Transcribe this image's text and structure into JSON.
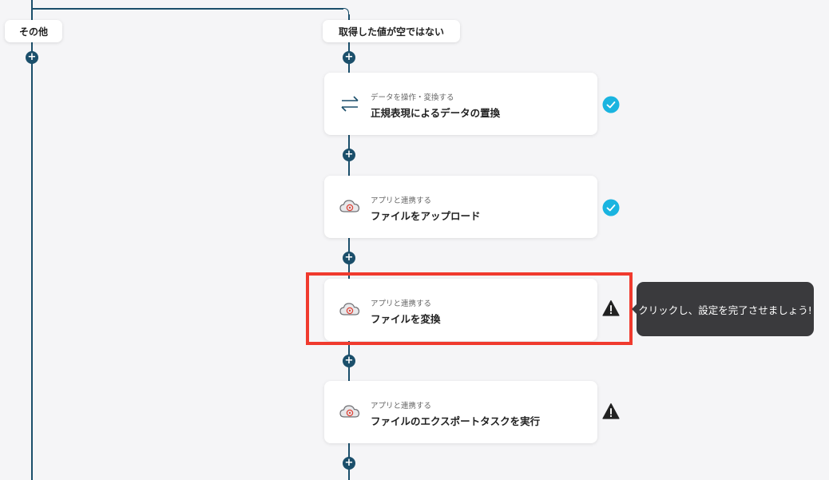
{
  "branches": {
    "other": "その他",
    "not_empty": "取得した値が空ではない"
  },
  "plus_symbol": "+",
  "steps": [
    {
      "category": "データを操作・変換する",
      "title": "正規表現によるデータの置換",
      "icon": "arrows-exchange-icon",
      "status": "complete"
    },
    {
      "category": "アプリと連携する",
      "title": "ファイルをアップロード",
      "icon": "cloud-app-icon",
      "status": "complete"
    },
    {
      "category": "アプリと連携する",
      "title": "ファイルを変換",
      "icon": "cloud-app-icon",
      "status": "warning"
    },
    {
      "category": "アプリと連携する",
      "title": "ファイルのエクスポートタスクを実行",
      "icon": "cloud-app-icon",
      "status": "warning"
    }
  ],
  "tooltip": {
    "text": "クリックし、設定を完了させましょう!"
  },
  "colors": {
    "connector": "#1b4f6b",
    "check": "#1ab4e0",
    "highlight": "#f03a2e",
    "tooltip_bg": "#3a3a3d",
    "background": "#f5f5f7"
  }
}
